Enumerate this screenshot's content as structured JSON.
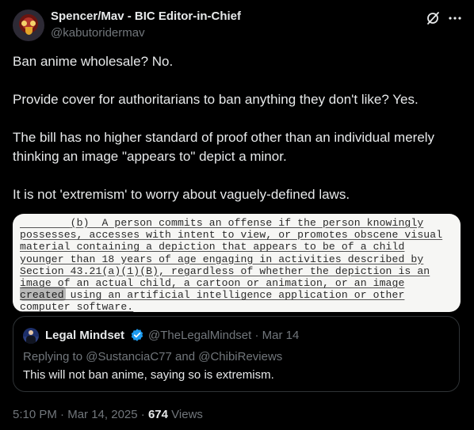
{
  "post": {
    "author_name": "Spencer/Mav - BIC Editor-in-Chief",
    "author_handle": "@kabutoridermav",
    "paragraphs": [
      "Ban anime wholesale? No.",
      "Provide cover for authoritarians to ban anything they don't like? Yes.",
      "The bill has no higher standard of proof other than an individual merely thinking an image \"appears to\" depict a minor.",
      "It is not 'extremism' to worry about vaguely-defined laws."
    ],
    "header_icons": [
      "grok-icon",
      "more-icon"
    ]
  },
  "image": {
    "lines": [
      "(b)  A person commits an offense if the person knowingly",
      "possesses, accesses with intent to view, or promotes obscene visual",
      "material containing a depiction that appears to be of a child",
      "younger than 18 years of age engaging in activities described by",
      "Section 43.21(a)(1)(B), regardless of whether the depiction is an",
      "image of an actual child, a cartoon or animation, or an image",
      "created using an artificial intelligence application or other",
      "computer software."
    ],
    "first_line_prefix": "        "
  },
  "quote": {
    "author_name": "Legal Mindset",
    "author_handle": "@TheLegalMindset",
    "separator": "·",
    "date": "Mar 14",
    "replying_prefix": "Replying to",
    "mention_1": "@SustanciaC77",
    "and_word": "and",
    "mention_2": "@ChibiReviews",
    "text": "This will not ban anime, saying so is extremism."
  },
  "footer": {
    "time": "5:10 PM",
    "separator1": "·",
    "date": "Mar 14, 2025",
    "separator2": "·",
    "views_count": "674",
    "views_label": "Views"
  },
  "colors": {
    "background": "#000000",
    "text_primary": "#e7e9ea",
    "text_secondary": "#71767b",
    "verified_blue": "#1d9bf0",
    "border": "#2f3336"
  }
}
